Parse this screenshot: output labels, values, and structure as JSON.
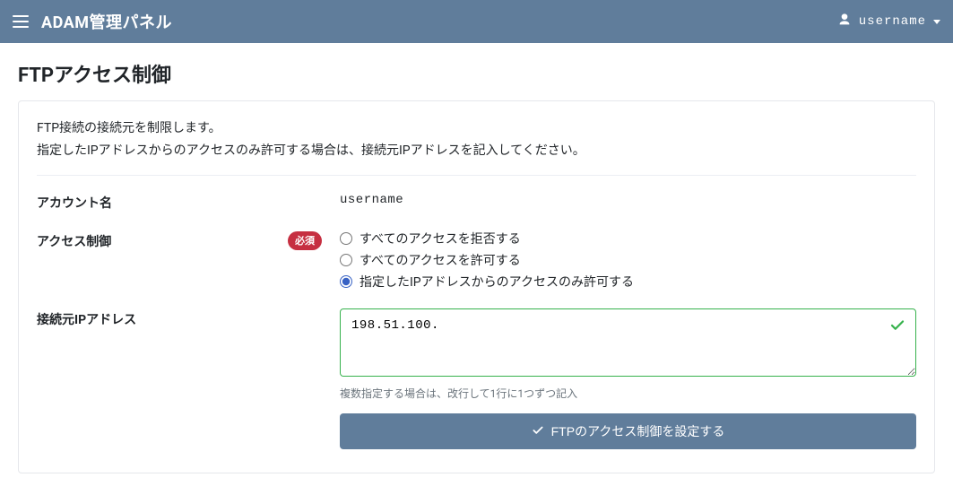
{
  "navbar": {
    "brand": "ADAM管理パネル",
    "username": "username"
  },
  "page": {
    "title": "FTPアクセス制御",
    "desc_line1": "FTP接続の接続元を制限します。",
    "desc_line2": "指定したIPアドレスからのアクセスのみ許可する場合は、接続元IPアドレスを記入してください。"
  },
  "form": {
    "account_label": "アカウント名",
    "account_value": "username",
    "access_label": "アクセス制御",
    "required_badge": "必須",
    "radios": {
      "deny_all": "すべてのアクセスを拒否する",
      "allow_all": "すべてのアクセスを許可する",
      "allow_specified": "指定したIPアドレスからのアクセスのみ許可する"
    },
    "radio_selected": "allow_specified",
    "ip_label": "接続元IPアドレス",
    "ip_value": "198.51.100.",
    "ip_hint": "複数指定する場合は、改行して1行に1つずつ記入",
    "submit_label": "FTPのアクセス制御を設定する"
  }
}
